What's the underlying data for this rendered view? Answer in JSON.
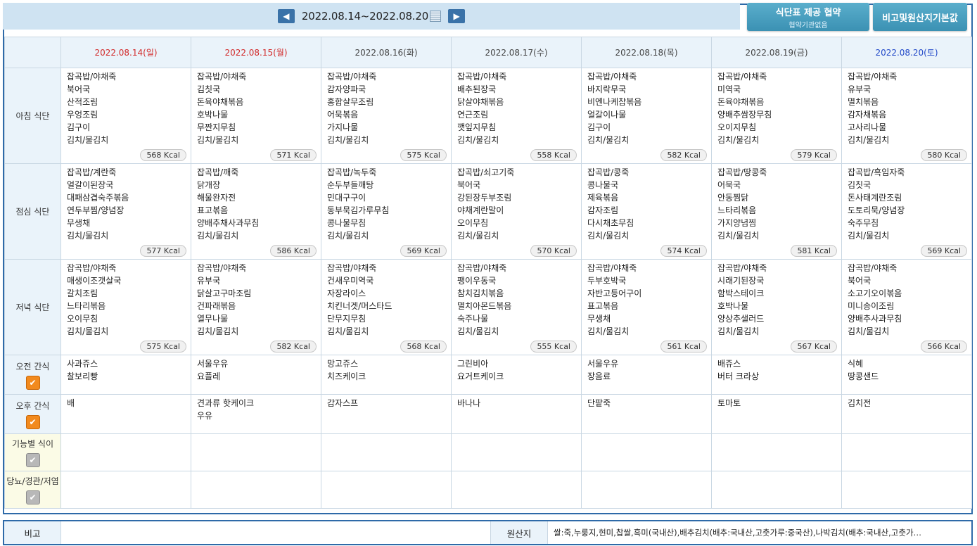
{
  "header": {
    "date_range": "2022.08.14~2022.08.20",
    "prev_icon": "chevron-left-icon",
    "next_icon": "chevron-right-icon",
    "calendar_icon": "calendar-icon",
    "btn_agreement_line1": "식단표 제공 협약",
    "btn_agreement_line2": "협약기관없음",
    "btn_remarks": "비고및원산지기본값"
  },
  "days": [
    {
      "label": "2022.08.14(일)",
      "type": "sun"
    },
    {
      "label": "2022.08.15(월)",
      "type": "sun"
    },
    {
      "label": "2022.08.16(화)",
      "type": "week"
    },
    {
      "label": "2022.08.17(수)",
      "type": "week"
    },
    {
      "label": "2022.08.18(목)",
      "type": "week"
    },
    {
      "label": "2022.08.19(금)",
      "type": "week"
    },
    {
      "label": "2022.08.20(토)",
      "type": "sat"
    }
  ],
  "meals": [
    {
      "label": "아침 식단",
      "days": [
        {
          "items": [
            "잡곡밥/야채죽",
            "북어국",
            "산적조림",
            "우엉조림",
            "김구이",
            "김치/물김치"
          ],
          "kcal": "568 Kcal"
        },
        {
          "items": [
            "잡곡밥/야채죽",
            "김칫국",
            "돈육야채볶음",
            "호박나물",
            "무짠지무침",
            "김치/물김치"
          ],
          "kcal": "571 Kcal"
        },
        {
          "items": [
            "잡곡밥/야채죽",
            "감자양파국",
            "홍합살무조림",
            "어묵볶음",
            "가지나물",
            "김치/물김치"
          ],
          "kcal": "575 Kcal"
        },
        {
          "items": [
            "잡곡밥/야채죽",
            "배추된장국",
            "닭살야채볶음",
            "연근조림",
            "깻잎지무침",
            "김치/물김치"
          ],
          "kcal": "558 Kcal"
        },
        {
          "items": [
            "잡곡밥/야채죽",
            "바지락무국",
            "비엔나케찹볶음",
            "얼갈이나물",
            "김구이",
            "김치/물김치"
          ],
          "kcal": "582 Kcal"
        },
        {
          "items": [
            "잡곡밥/야채죽",
            "미역국",
            "돈육야채볶음",
            "양배추쌈장무침",
            "오이지무침",
            "김치/물김치"
          ],
          "kcal": "579 Kcal"
        },
        {
          "items": [
            "잡곡밥/야채죽",
            "유부국",
            "멸치볶음",
            "감자채볶음",
            "고사리나물",
            "김치/물김치"
          ],
          "kcal": "580 Kcal"
        }
      ]
    },
    {
      "label": "점심 식단",
      "days": [
        {
          "items": [
            "잡곡밥/계란죽",
            "얼갈이된장국",
            "대패삼겹숙주볶음",
            "연두부찜/양념장",
            "무생채",
            "김치/물김치"
          ],
          "kcal": "577 Kcal"
        },
        {
          "items": [
            "잡곡밥/깨죽",
            "닭개장",
            "해물완자전",
            "표고볶음",
            "양배추채사과무침",
            "김치/물김치"
          ],
          "kcal": "586 Kcal"
        },
        {
          "items": [
            "잡곡밥/녹두죽",
            "순두부들깨탕",
            "민대구구이",
            "동부묵김가루무침",
            "콩나물무침",
            "김치/물김치"
          ],
          "kcal": "569 Kcal"
        },
        {
          "items": [
            "잡곡밥/쇠고기죽",
            "북어국",
            "강된장두부조림",
            "야채계란말이",
            "오이무침",
            "김치/물김치"
          ],
          "kcal": "570 Kcal"
        },
        {
          "items": [
            "잡곡밥/콩죽",
            "콩나물국",
            "제육볶음",
            "감자조림",
            "다시채초무침",
            "김치/물김치"
          ],
          "kcal": "574 Kcal"
        },
        {
          "items": [
            "잡곡밥/땅콩죽",
            "어묵국",
            "안동찜닭",
            "느타리볶음",
            "가지양념찜",
            "김치/물김치"
          ],
          "kcal": "581 Kcal"
        },
        {
          "items": [
            "잡곡밥/흑임자죽",
            "김칫국",
            "돈사태계란조림",
            "도토리묵/양념장",
            "숙주무침",
            "김치/물김치"
          ],
          "kcal": "569 Kcal"
        }
      ]
    },
    {
      "label": "저녁 식단",
      "days": [
        {
          "items": [
            "잡곡밥/야채죽",
            "매생이조갯살국",
            "갈치조림",
            "느타리볶음",
            "오이무침",
            "김치/물김치"
          ],
          "kcal": "575 Kcal"
        },
        {
          "items": [
            "잡곡밥/야채죽",
            "유부국",
            "닭살고구마조림",
            "건파래볶음",
            "열무나물",
            "김치/물김치"
          ],
          "kcal": "582 Kcal"
        },
        {
          "items": [
            "잡곡밥/야채죽",
            "건새우미역국",
            "자장라이스",
            "치킨너겟/머스타드",
            "단무지무침",
            "김치/물김치"
          ],
          "kcal": "568 Kcal"
        },
        {
          "items": [
            "잡곡밥/야채죽",
            "팽이우동국",
            "참치김치볶음",
            "멸치아몬드볶음",
            "숙주나물",
            "김치/물김치"
          ],
          "kcal": "555 Kcal"
        },
        {
          "items": [
            "잡곡밥/야채죽",
            "두부호박국",
            "자반고등어구이",
            "표고볶음",
            "무생채",
            "김치/물김치"
          ],
          "kcal": "561 Kcal"
        },
        {
          "items": [
            "잡곡밥/야채죽",
            "시래기된장국",
            "함박스테이크",
            "호박나물",
            "양상추샐러드",
            "김치/물김치"
          ],
          "kcal": "567 Kcal"
        },
        {
          "items": [
            "잡곡밥/야채죽",
            "북어국",
            "소고기오이볶음",
            "미니송이조림",
            "양배추사과무침",
            "김치/물김치"
          ],
          "kcal": "566 Kcal"
        }
      ]
    }
  ],
  "snacks": [
    {
      "label": "오전 간식",
      "checked": true,
      "days": [
        [
          "사과쥬스",
          "찰보리빵"
        ],
        [
          "서울우유",
          "요플레"
        ],
        [
          "망고쥬스",
          "치즈케이크"
        ],
        [
          "그린비아",
          "요거트케이크"
        ],
        [
          "서울우유",
          "장음료"
        ],
        [
          "배쥬스",
          "버터 크라상"
        ],
        [
          "식혜",
          "땅콩샌드"
        ]
      ]
    },
    {
      "label": "오후 간식",
      "checked": true,
      "days": [
        [
          "배"
        ],
        [
          "견과류 핫케이크",
          "우유"
        ],
        [
          "감자스프"
        ],
        [
          "바나나"
        ],
        [
          "단팥죽"
        ],
        [
          "토마토"
        ],
        [
          "김치전"
        ]
      ]
    }
  ],
  "special": [
    {
      "label": "기능별 식이",
      "checked": false
    },
    {
      "label": "당뇨/경관/저염",
      "checked": false
    }
  ],
  "footer": {
    "remarks_label": "비고",
    "remarks_value": "",
    "origin_label": "원산지",
    "origin_value": "쌀:죽,누룽지,현미,찹쌀,흑미(국내산),배추김치(배추:국내산,고춧가루:중국산),나박김치(배추:국내산,고춧가…"
  },
  "colors": {
    "frame": "#2e6aa8",
    "header_bg": "#eaf3fa",
    "check_on": "#f28a1e",
    "check_off": "#b8b8b8"
  }
}
